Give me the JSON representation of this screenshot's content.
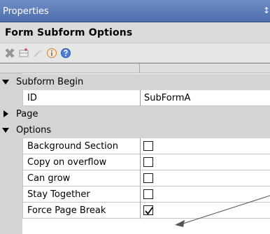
{
  "window": {
    "title": "Properties",
    "pin_glyph": "↕"
  },
  "panel": {
    "title": "Form Subform Options"
  },
  "toolbar": {
    "buttons": [
      {
        "icon": "delete-icon"
      },
      {
        "icon": "new-row-icon"
      },
      {
        "icon": "wand-icon"
      },
      {
        "icon": "info-icon"
      },
      {
        "icon": "help-icon"
      }
    ]
  },
  "grid": {
    "subform_begin": {
      "label": "Subform Begin",
      "rows": [
        {
          "name": "ID",
          "value": "SubFormA"
        }
      ]
    },
    "page": {
      "label": "Page"
    },
    "options": {
      "label": "Options",
      "rows": [
        {
          "name": "Background Section",
          "checked": false
        },
        {
          "name": "Copy on overflow",
          "checked": false
        },
        {
          "name": "Can grow",
          "checked": false
        },
        {
          "name": "Stay Together",
          "checked": false
        },
        {
          "name": "Force Page Break",
          "checked": true
        }
      ]
    }
  },
  "colors": {
    "title_bar": "#5b7bb8",
    "category_bg": "#d4d4d4",
    "header_bg": "#dcdcdc"
  }
}
